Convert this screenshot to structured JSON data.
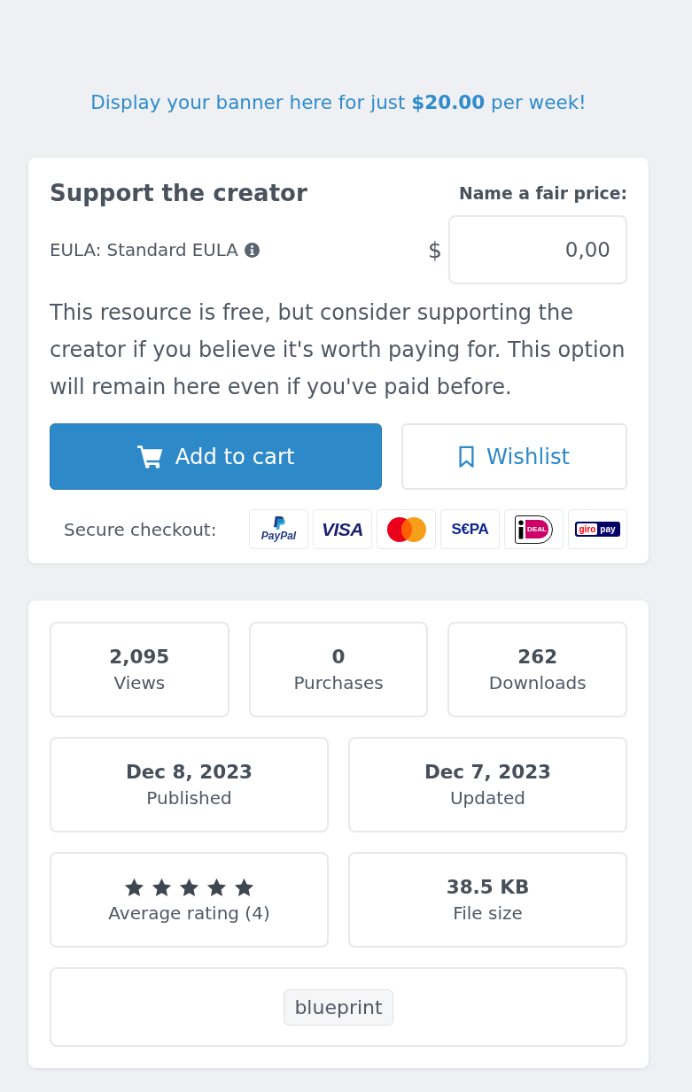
{
  "banner": {
    "text": "Display your banner here for just **$20.00** per week!"
  },
  "support_card": {
    "title": "Support the creator",
    "price_label": "Name a fair price:",
    "eula": "EULA: Standard EULA",
    "currency": "$",
    "price_field": {
      "value": "0,00"
    },
    "description": "This resource is free, but consider supporting the creator if you believe it's worth paying for. This option will remain here even if you've paid before.",
    "buttons": [
      {
        "kind": "primary",
        "label": "Add to cart"
      },
      {
        "kind": "secondary",
        "label": "Wishlist"
      }
    ],
    "checkout": {
      "label": "Secure checkout:",
      "methods": [
        {
          "kind": "paypal",
          "text": "PayPal"
        },
        {
          "kind": "visa",
          "text": "VISA"
        },
        {
          "kind": "mastercard"
        },
        {
          "kind": "sepa",
          "text": "S€PA"
        },
        {
          "kind": "ideal",
          "text": "DEAL"
        },
        {
          "kind": "giropay",
          "text": "giro",
          "text_2": "pay"
        }
      ]
    }
  },
  "stats_card": {
    "stat_rows": [
      [
        {
          "kind": "number",
          "value": "2,095",
          "label": "Views"
        },
        {
          "kind": "number",
          "value": "0",
          "label": "Purchases"
        },
        {
          "kind": "number",
          "value": "262",
          "label": "Downloads"
        }
      ],
      [
        {
          "kind": "number",
          "value": "Dec 8, 2023",
          "label": "Published"
        },
        {
          "kind": "number",
          "value": "Dec 7, 2023",
          "label": "Updated"
        }
      ],
      [
        {
          "kind": "rating",
          "stars": 5,
          "label": "Average rating (4)"
        },
        {
          "kind": "number",
          "value": "38.5 KB",
          "label": "File size"
        }
      ]
    ],
    "tags": [
      "blueprint"
    ]
  }
}
